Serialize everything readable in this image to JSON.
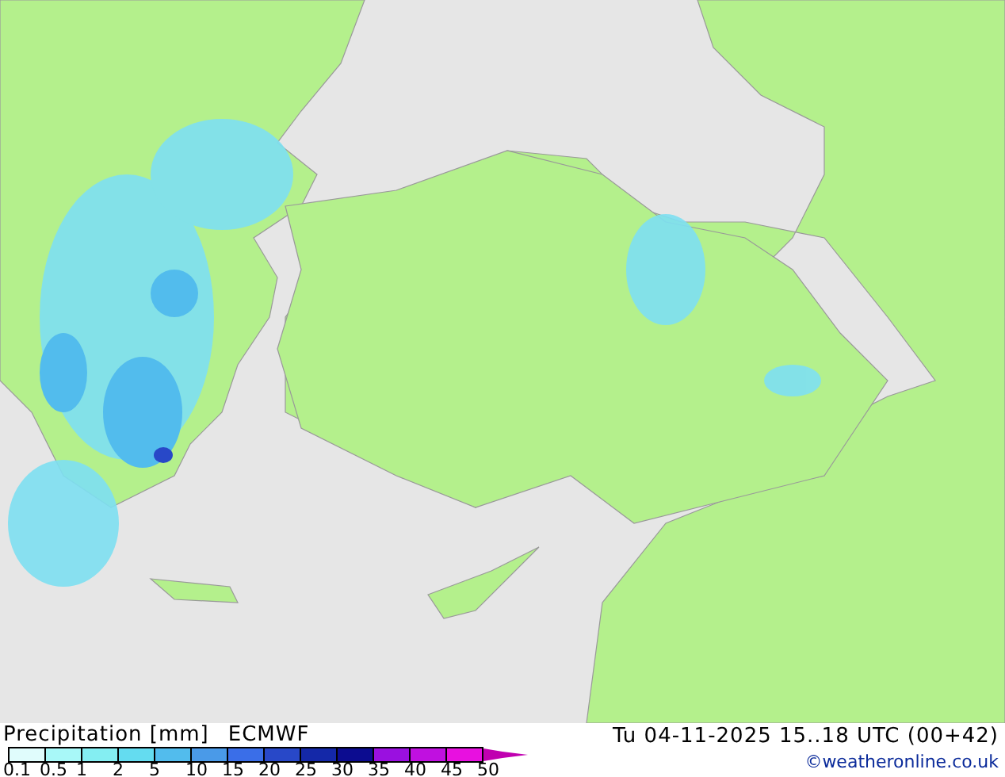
{
  "legend": {
    "title": "Precipitation [mm]",
    "model": "ECMWF",
    "bins": [
      {
        "color": "#e0fcfc"
      },
      {
        "color": "#a8f8f8"
      },
      {
        "color": "#84eef2"
      },
      {
        "color": "#64dcf0"
      },
      {
        "color": "#52bced"
      },
      {
        "color": "#4a9ae8"
      },
      {
        "color": "#3a6ee8"
      },
      {
        "color": "#2848c8"
      },
      {
        "color": "#1428a8"
      },
      {
        "color": "#0c0c90"
      },
      {
        "color": "#9a10e0"
      },
      {
        "color": "#c010e0"
      },
      {
        "color": "#e810e0"
      },
      {
        "color": "#c000b0"
      }
    ],
    "ticks": [
      "0.1",
      "0.5",
      "1",
      "2",
      "5",
      "10",
      "15",
      "20",
      "25",
      "30",
      "35",
      "40",
      "45",
      "50"
    ]
  },
  "valid_time": "Tu 04-11-2025 15..18 UTC (00+42)",
  "credit": "©weatheronline.co.uk"
}
